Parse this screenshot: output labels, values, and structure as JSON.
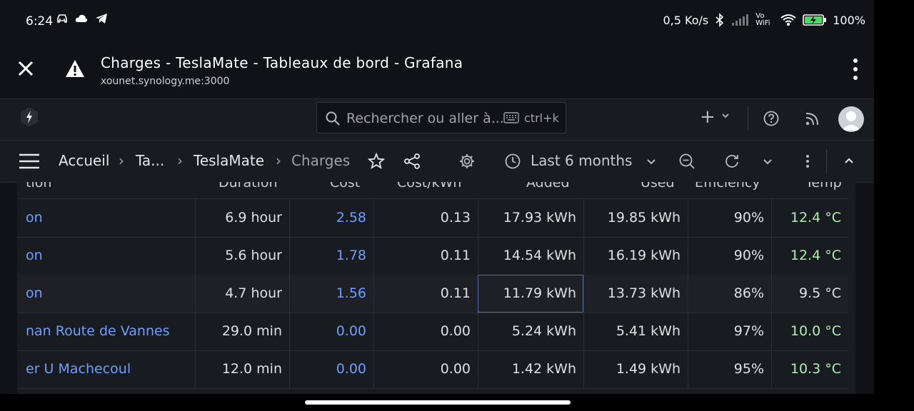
{
  "status_bar": {
    "time": "6:24",
    "net_speed": "0,5 Ko/s",
    "vowifi": "Vo WiFi",
    "battery": "100%"
  },
  "browser": {
    "title": "Charges - TeslaMate - Tableaux de bord - Grafana",
    "url": "xounet.synology.me:3000"
  },
  "grafana_top": {
    "search_placeholder": "Rechercher ou aller à...",
    "search_shortcut": "ctrl+k",
    "plus_label": "+"
  },
  "breadcrumb": {
    "items": [
      "Accueil",
      "Ta...",
      "TeslaMate",
      "Charges"
    ],
    "separator": "›"
  },
  "toolbar": {
    "time_range": "Last 6 months"
  },
  "table": {
    "columns": [
      "tion",
      "Duration",
      "Cost",
      "Cost/kWh",
      "Added",
      "Used",
      "Efficiency",
      "Temp"
    ],
    "rows": [
      {
        "location": "on",
        "duration": "6.9 hour",
        "cost": "2.58",
        "cost_kwh": "0.13",
        "added": "17.93 kWh",
        "used": "19.85 kWh",
        "efficiency": "90%",
        "temp": "12.4 °C"
      },
      {
        "location": "on",
        "duration": "5.6 hour",
        "cost": "1.78",
        "cost_kwh": "0.11",
        "added": "14.54 kWh",
        "used": "16.19 kWh",
        "efficiency": "90%",
        "temp": "12.4 °C"
      },
      {
        "location": "on",
        "duration": "4.7 hour",
        "cost": "1.56",
        "cost_kwh": "0.11",
        "added": "11.79 kWh",
        "used": "13.73 kWh",
        "efficiency": "86%",
        "temp": "9.5 °C"
      },
      {
        "location": "nan Route de Vannes",
        "duration": "29.0 min",
        "cost": "0.00",
        "cost_kwh": "0.00",
        "added": "5.24 kWh",
        "used": "5.41 kWh",
        "efficiency": "97%",
        "temp": "10.0 °C"
      },
      {
        "location": "er U Machecoul",
        "duration": "12.0 min",
        "cost": "0.00",
        "cost_kwh": "0.00",
        "added": "1.42 kWh",
        "used": "1.49 kWh",
        "efficiency": "95%",
        "temp": "10.3 °C"
      }
    ]
  },
  "colors": {
    "link": "#6e9fff",
    "temp_green": "#b3ecb3",
    "panel_bg": "#181b1f",
    "page_bg": "#111217"
  }
}
